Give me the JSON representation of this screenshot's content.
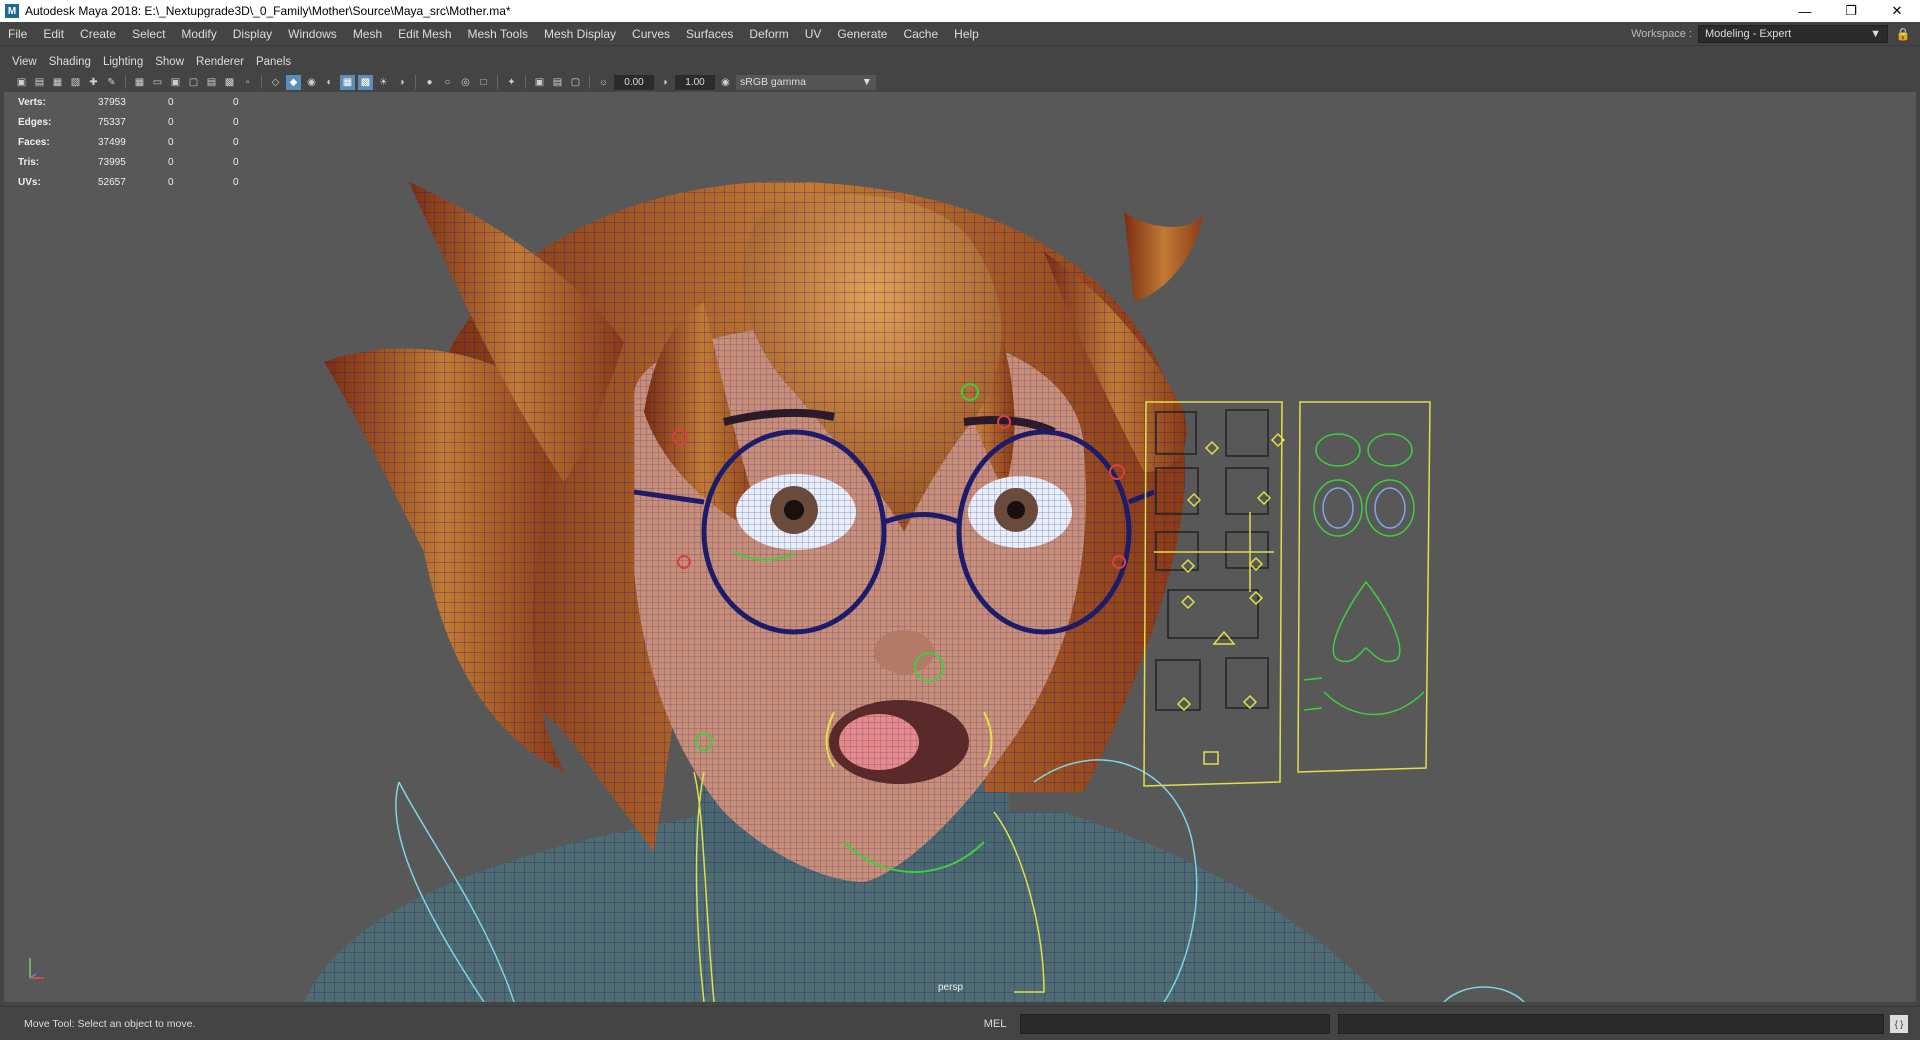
{
  "window": {
    "title": "Autodesk Maya 2018: E:\\_Nextupgrade3D\\_0_Family\\Mother\\Source\\Maya_src\\Mother.ma*",
    "app_icon": "M",
    "controls": [
      "minimize-icon",
      "restore-icon",
      "close-icon"
    ]
  },
  "menubar": {
    "items": [
      "File",
      "Edit",
      "Create",
      "Select",
      "Modify",
      "Display",
      "Windows",
      "Mesh",
      "Edit Mesh",
      "Mesh Tools",
      "Mesh Display",
      "Curves",
      "Surfaces",
      "Deform",
      "UV",
      "Generate",
      "Cache",
      "Help"
    ],
    "workspace_label": "Workspace :",
    "workspace_value": "Modeling - Expert"
  },
  "panel_menu": [
    "View",
    "Shading",
    "Lighting",
    "Show",
    "Renderer",
    "Panels"
  ],
  "viewport_toolbar": {
    "exposure": "0.00",
    "gamma": "1.00",
    "color_space": "sRGB gamma"
  },
  "hud": {
    "rows": [
      {
        "label": "Verts:",
        "v1": "37953",
        "v2": "0",
        "v3": "0"
      },
      {
        "label": "Edges:",
        "v1": "75337",
        "v2": "0",
        "v3": "0"
      },
      {
        "label": "Faces:",
        "v1": "37499",
        "v2": "0",
        "v3": "0"
      },
      {
        "label": "Tris:",
        "v1": "73995",
        "v2": "0",
        "v3": "0"
      },
      {
        "label": "UVs:",
        "v1": "52657",
        "v2": "0",
        "v3": "0"
      }
    ],
    "camera": "persp"
  },
  "statusbar": {
    "help_line": "Move Tool: Select an object to move.",
    "command_label": "MEL"
  },
  "colors": {
    "viewport_bg": "#585858",
    "ui_bg": "#444444",
    "hair": "#a0581f",
    "skin": "#c98e78",
    "wireframe": "#1a1a6e",
    "controls_yellow": "#e0e04a",
    "controls_green": "#3ecf3e",
    "controls_cyan": "#7fd4e8"
  }
}
